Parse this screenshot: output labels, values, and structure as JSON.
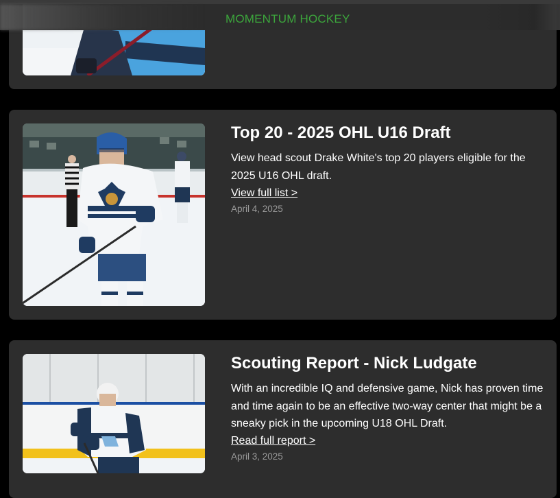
{
  "header": {
    "brand": "MOMENTUM HOCKEY"
  },
  "articles": [
    {
      "title": "Top 20 - 2025 OHL U16 Draft",
      "description": "View head scout Drake White's top 20 players eligible for the 2025 U16 OHL draft.",
      "link_label": "View full list >",
      "date": "April 4, 2025"
    },
    {
      "title": "Scouting Report - Nick Ludgate",
      "description": "With an incredible IQ and defensive game, Nick has proven time and time again to be an effective two-way center that might be a sneaky pick in the upcoming U18 OHL Draft.",
      "link_label": "Read full report >",
      "date": "April 3, 2025"
    }
  ],
  "colors": {
    "brand": "#3ca63c",
    "card": "#2d2d2d",
    "background": "#000000"
  }
}
